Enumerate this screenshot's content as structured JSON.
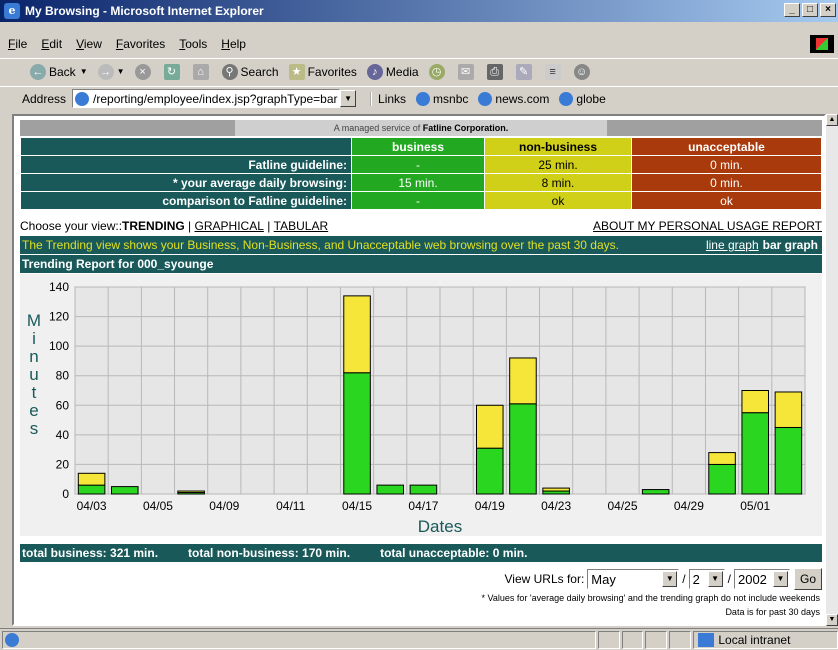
{
  "window": {
    "title": "My Browsing - Microsoft Internet Explorer",
    "min": "_",
    "max": "□",
    "close": "×"
  },
  "menu": [
    "File",
    "Edit",
    "View",
    "Favorites",
    "Tools",
    "Help"
  ],
  "toolbar": {
    "back": "Back",
    "search": "Search",
    "favorites": "Favorites",
    "media": "Media"
  },
  "address": {
    "label": "Address",
    "value": "/reporting/employee/index.jsp?graphType=bar",
    "links_label": "Links",
    "links": [
      "msnbc",
      "news.com",
      "globe"
    ]
  },
  "page": {
    "managed_prefix": "A managed service of ",
    "managed_company": "Fatline Corporation.",
    "guide": {
      "headers": [
        "business",
        "non-business",
        "unacceptable"
      ],
      "rows": [
        {
          "label": "Fatline guideline:",
          "values": [
            "-",
            "25 min.",
            "0 min."
          ]
        },
        {
          "label": "* your average daily browsing:",
          "values": [
            "15 min.",
            "8 min.",
            "0 min."
          ]
        },
        {
          "label": "comparison to Fatline guideline:",
          "values": [
            "-",
            "ok",
            "ok"
          ]
        }
      ]
    },
    "view_prefix": "Choose your view:: ",
    "view_current": "TRENDING",
    "view_graphical": "GRAPHICAL",
    "view_tabular": "TABULAR",
    "view_sep": " | ",
    "about": "ABOUT MY PERSONAL USAGE REPORT",
    "description": "The Trending view shows your Business, Non-Business, and Unacceptable web browsing over the past 30 days.",
    "line_graph": "line graph",
    "bar_graph": "bar graph",
    "report_title": "Trending Report for 000_syounge",
    "totals": [
      "total business: 321 min.",
      "total non-business: 170 min.",
      "total unacceptable: 0 min."
    ],
    "view_urls_label": "View URLs for:",
    "month": "May",
    "day": "2",
    "year": "2002",
    "go": "Go",
    "slash": "/",
    "note1": "* Values for 'average daily browsing' and the trending graph do not include weekends",
    "note2": "Data is for past 30 days"
  },
  "status": {
    "zone": "Local intranet"
  },
  "colors": {
    "business": "#2ad61f",
    "nonbusiness": "#f6e63a",
    "header_teal": "#19595a"
  },
  "chart_data": {
    "type": "bar",
    "stacked": true,
    "xlabel": "Dates",
    "ylabel": "Minutes",
    "ylim": [
      0,
      140
    ],
    "yticks": [
      0,
      20,
      40,
      60,
      80,
      100,
      120,
      140
    ],
    "grid": true,
    "tick_labels": [
      "04/03",
      "04/05",
      "04/09",
      "04/11",
      "04/15",
      "04/17",
      "04/19",
      "04/23",
      "04/25",
      "04/29",
      "05/01"
    ],
    "categories": [
      "04/03",
      "04/04",
      "04/05",
      "04/08",
      "04/09",
      "04/10",
      "04/11",
      "04/12",
      "04/15",
      "04/16",
      "04/17",
      "04/18",
      "04/19",
      "04/22",
      "04/23",
      "04/24",
      "04/25",
      "04/26",
      "04/29",
      "04/30",
      "05/01",
      "05/02"
    ],
    "series": [
      {
        "name": "business",
        "values": [
          6,
          5,
          0,
          1,
          0,
          0,
          0,
          0,
          82,
          6,
          6,
          0,
          31,
          61,
          2,
          0,
          0,
          3,
          0,
          20,
          55,
          45
        ]
      },
      {
        "name": "non-business",
        "values": [
          8,
          0,
          0,
          1,
          0,
          0,
          0,
          0,
          52,
          0,
          0,
          0,
          29,
          31,
          2,
          0,
          0,
          0,
          0,
          8,
          15,
          24
        ]
      }
    ]
  }
}
